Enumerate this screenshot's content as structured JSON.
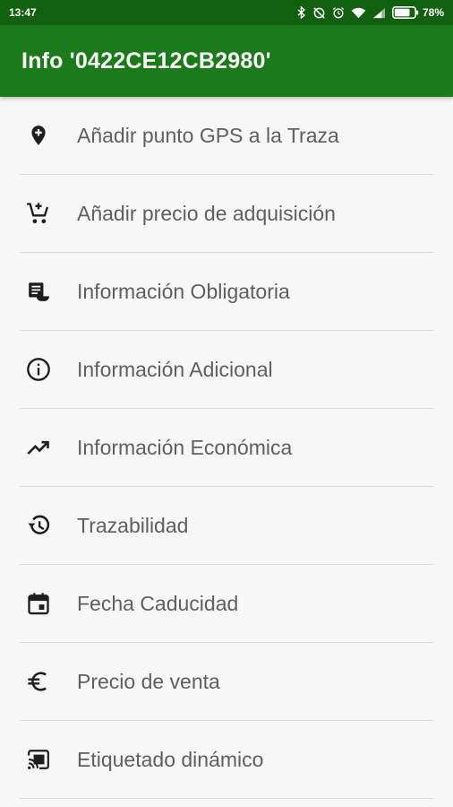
{
  "status_bar": {
    "time": "13:47",
    "battery_percent": "78%",
    "battery_level": 0.78
  },
  "app_bar": {
    "title": "Info '0422CE12CB2980'"
  },
  "menu": {
    "items": [
      {
        "label": "Añadir punto GPS a la Traza",
        "icon": "add-location-icon"
      },
      {
        "label": "Añadir precio de adquisición",
        "icon": "add-shopping-cart-icon"
      },
      {
        "label": "Información Obligatoria",
        "icon": "receipt-list-icon"
      },
      {
        "label": "Información Adicional",
        "icon": "info-icon"
      },
      {
        "label": "Información Económica",
        "icon": "trending-up-icon"
      },
      {
        "label": "Trazabilidad",
        "icon": "history-icon"
      },
      {
        "label": "Fecha Caducidad",
        "icon": "calendar-icon"
      },
      {
        "label": "Precio de venta",
        "icon": "euro-icon"
      },
      {
        "label": "Etiquetado dinámico",
        "icon": "cast-icon"
      }
    ]
  },
  "colors": {
    "status_bar": "#116010",
    "app_bar": "#1b7a1a",
    "background": "#f7f7f7",
    "label_text": "#5f5f5f",
    "icon": "#1e1e1e"
  }
}
